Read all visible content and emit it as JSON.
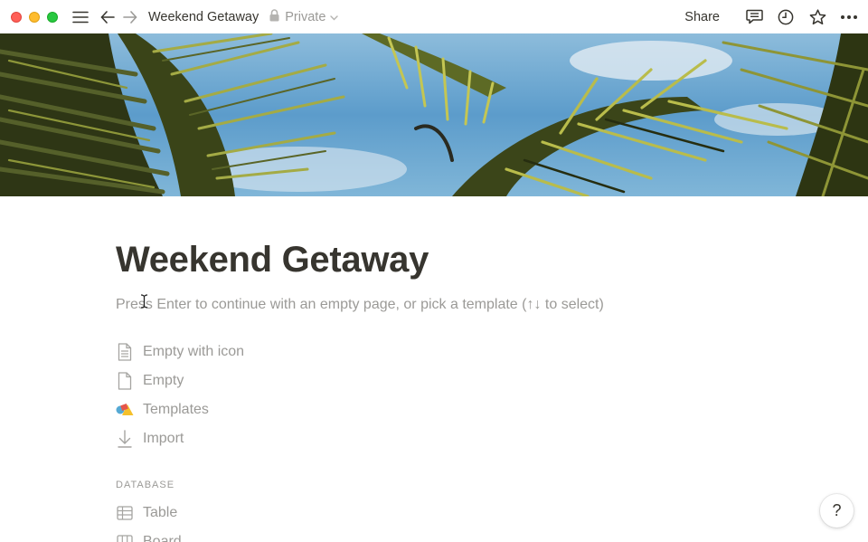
{
  "window": {
    "controls": [
      "close",
      "minimize",
      "maximize"
    ]
  },
  "topbar": {
    "menu_icon": "hamburger-icon",
    "back_icon": "arrow-left-icon",
    "forward_icon": "arrow-right-icon",
    "breadcrumb": "Weekend Getaway",
    "privacy_label": "Private",
    "privacy_icon": "lock-icon",
    "share_label": "Share",
    "right_icons": [
      "comment-icon",
      "clock-history-icon",
      "star-icon",
      "more-horizontal-icon"
    ]
  },
  "cover": {
    "description_icon": "palm-leaves-cover-image",
    "colors": {
      "sky": "#6aa8d2",
      "leaf_dark": "#2f3a16",
      "leaf_light": "#9aa23a"
    }
  },
  "page": {
    "title": "Weekend Getaway",
    "hint": "Press Enter to continue with an empty page, or pick a template (↑↓ to select)"
  },
  "options": [
    {
      "label": "Empty with icon",
      "icon": "page-lines-icon"
    },
    {
      "label": "Empty",
      "icon": "page-icon"
    },
    {
      "label": "Templates",
      "icon": "shapes-icon"
    },
    {
      "label": "Import",
      "icon": "arrow-down-icon"
    }
  ],
  "database": {
    "section_label": "DATABASE",
    "items": [
      {
        "label": "Table",
        "icon": "table-icon"
      },
      {
        "label": "Board",
        "icon": "board-icon"
      }
    ]
  },
  "help": {
    "label": "?"
  },
  "colors": {
    "text": "#37352f",
    "muted": "#9b9a97",
    "close": "#ff5f57",
    "minimize": "#febc2e",
    "maximize": "#28c840"
  }
}
